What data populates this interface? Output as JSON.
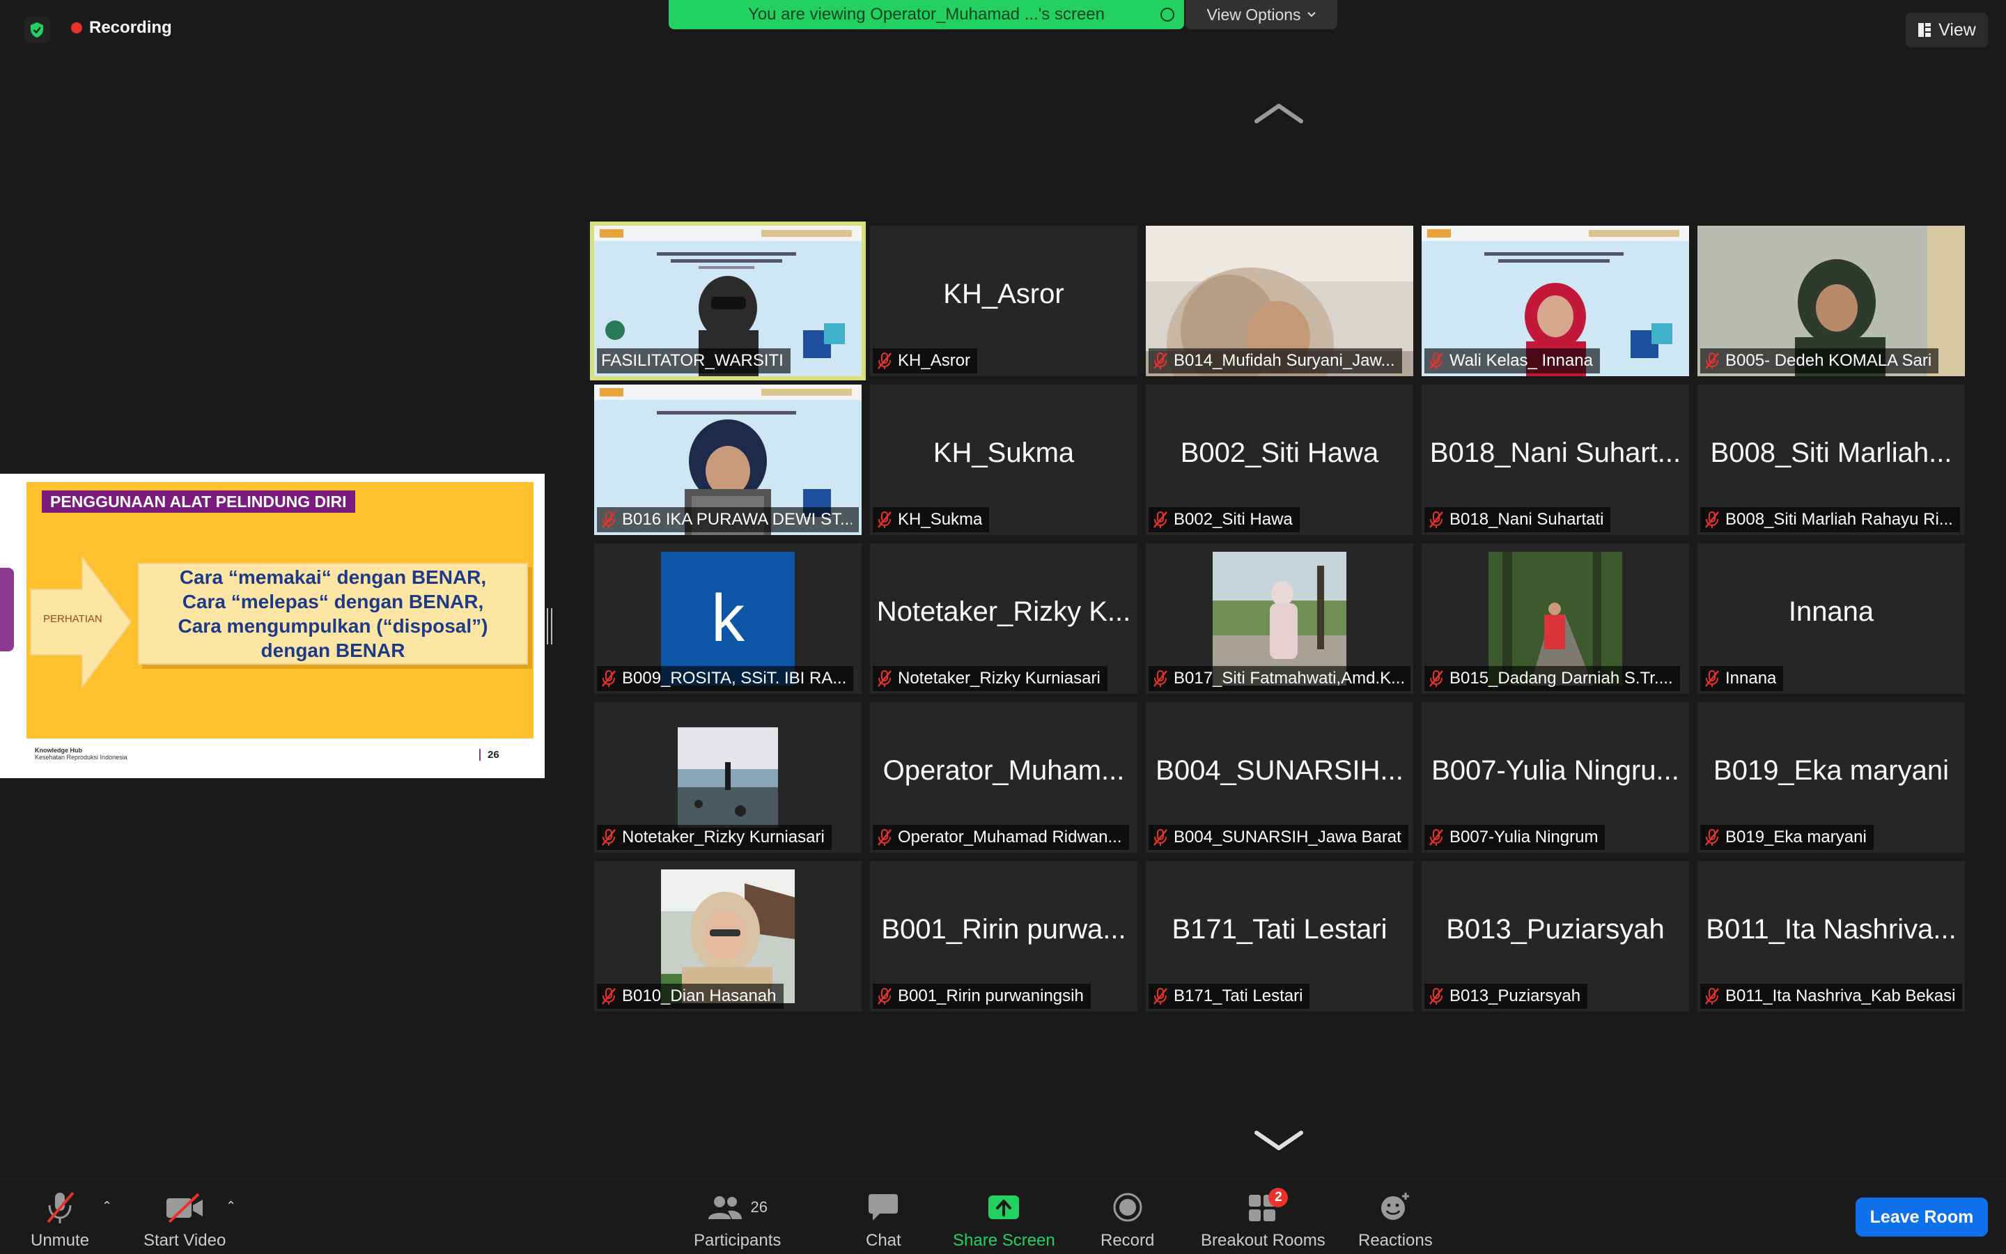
{
  "top": {
    "recording": "Recording",
    "viewing_banner": "You are viewing Operator_Muhamad ...'s screen",
    "view_options": "View Options",
    "view": "View"
  },
  "slide": {
    "title": "PENGGUNAAN ALAT PELINDUNG DIRI",
    "arrow_label": "PERHATIAN",
    "lines": [
      "Cara “memakai“ dengan  BENAR,",
      "Cara “melepas“ dengan BENAR,",
      "Cara mengumpulkan (“disposal”)",
      "dengan BENAR"
    ],
    "footer_line1": "Knowledge Hub",
    "footer_line2": "Kesehatan Reproduksi Indonesia",
    "page": "26"
  },
  "tiles": [
    {
      "big": "",
      "name": "FASILITATOR_WARSITI",
      "muted": false
    },
    {
      "big": "KH_Asror",
      "name": "KH_Asror",
      "muted": true
    },
    {
      "big": "",
      "name": "B014_Mufidah Suryani_Jaw...",
      "muted": true
    },
    {
      "big": "",
      "name": "Wali Kelas_ Innana",
      "muted": true
    },
    {
      "big": "",
      "name": "B005- Dedeh KOMALA Sari",
      "muted": true
    },
    {
      "big": "",
      "name": "B016 IKA PURAWA DEWI ST...",
      "muted": true
    },
    {
      "big": "KH_Sukma",
      "name": "KH_Sukma",
      "muted": true
    },
    {
      "big": "B002_Siti Hawa",
      "name": "B002_Siti Hawa",
      "muted": true
    },
    {
      "big": "B018_Nani Suhart...",
      "name": "B018_Nani Suhartati",
      "muted": true
    },
    {
      "big": "B008_Siti Marliah...",
      "name": "B008_Siti Marliah Rahayu Ri...",
      "muted": true
    },
    {
      "big": "",
      "name": "B009_ROSITA, SSiT. IBI RA...",
      "muted": true
    },
    {
      "big": "Notetaker_Rizky K...",
      "name": "Notetaker_Rizky Kurniasari",
      "muted": true
    },
    {
      "big": "",
      "name": "B017_Siti Fatmahwati,Amd.K...",
      "muted": true
    },
    {
      "big": "",
      "name": "B015_Dadang Darniah S.Tr....",
      "muted": true
    },
    {
      "big": "Innana",
      "name": "Innana",
      "muted": true
    },
    {
      "big": "",
      "name": "Notetaker_Rizky Kurniasari",
      "muted": true
    },
    {
      "big": "Operator_Muham...",
      "name": "Operator_Muhamad Ridwan...",
      "muted": true
    },
    {
      "big": "B004_SUNARSIH...",
      "name": "B004_SUNARSIH_Jawa Barat",
      "muted": true
    },
    {
      "big": "B007-Yulia Ningru...",
      "name": "B007-Yulia Ningrum",
      "muted": true
    },
    {
      "big": "B019_Eka maryani",
      "name": "B019_Eka maryani",
      "muted": true
    },
    {
      "big": "",
      "name": "B010_Dian Hasanah",
      "muted": true
    },
    {
      "big": "B001_Ririn purwa...",
      "name": "B001_Ririn purwaningsih",
      "muted": true
    },
    {
      "big": "B171_Tati Lestari",
      "name": "B171_Tati Lestari",
      "muted": true
    },
    {
      "big": "B013_Puziarsyah",
      "name": "B013_Puziarsyah",
      "muted": true
    },
    {
      "big": "B011_Ita Nashriva...",
      "name": "B011_Ita Nashriva_Kab Bekasi",
      "muted": true
    }
  ],
  "avatar_letter": "k",
  "toolbar": {
    "unmute": "Unmute",
    "start_video": "Start Video",
    "participants": "Participants",
    "participants_count": "26",
    "chat": "Chat",
    "share_screen": "Share Screen",
    "record": "Record",
    "breakout_rooms": "Breakout Rooms",
    "breakout_badge": "2",
    "reactions": "Reactions",
    "leave": "Leave Room"
  },
  "colors": {
    "banner": "#23d160",
    "leave": "#0e71eb",
    "active_speaker": "#d9e07a",
    "muted": "#e8322b"
  }
}
